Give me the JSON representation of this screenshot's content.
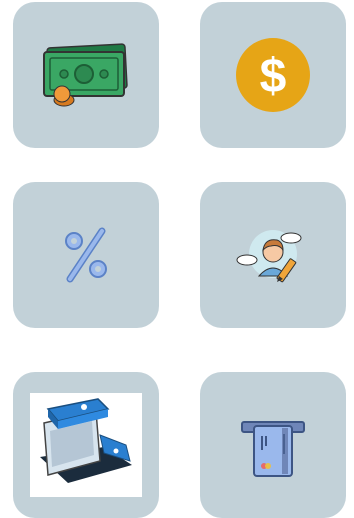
{
  "tiles": [
    {
      "id": "cash",
      "icon": "cash-banknote-icon",
      "colors": {
        "note": "#2e9a5a",
        "coin": "#e8922e"
      }
    },
    {
      "id": "dollar",
      "icon": "dollar-coin-icon",
      "colors": {
        "coin": "#e6a516",
        "symbol": "#ffffff"
      }
    },
    {
      "id": "percent",
      "icon": "percent-icon",
      "colors": {
        "glyph": "#8fb1e8"
      }
    },
    {
      "id": "profile",
      "icon": "user-edit-icon",
      "colors": {
        "bubble": "#cfe9ef",
        "pencil": "#f0a53a"
      }
    },
    {
      "id": "terminal",
      "icon": "card-terminal-icon",
      "colors": {
        "body": "#2a7fd0",
        "base": "#1b2c3d"
      }
    },
    {
      "id": "card",
      "icon": "card-insert-icon",
      "colors": {
        "card": "#8aa9d8",
        "slot": "#5672a8"
      }
    }
  ],
  "colors": {
    "tile_background": "#c2d1d8",
    "page_background": "#ffffff"
  }
}
